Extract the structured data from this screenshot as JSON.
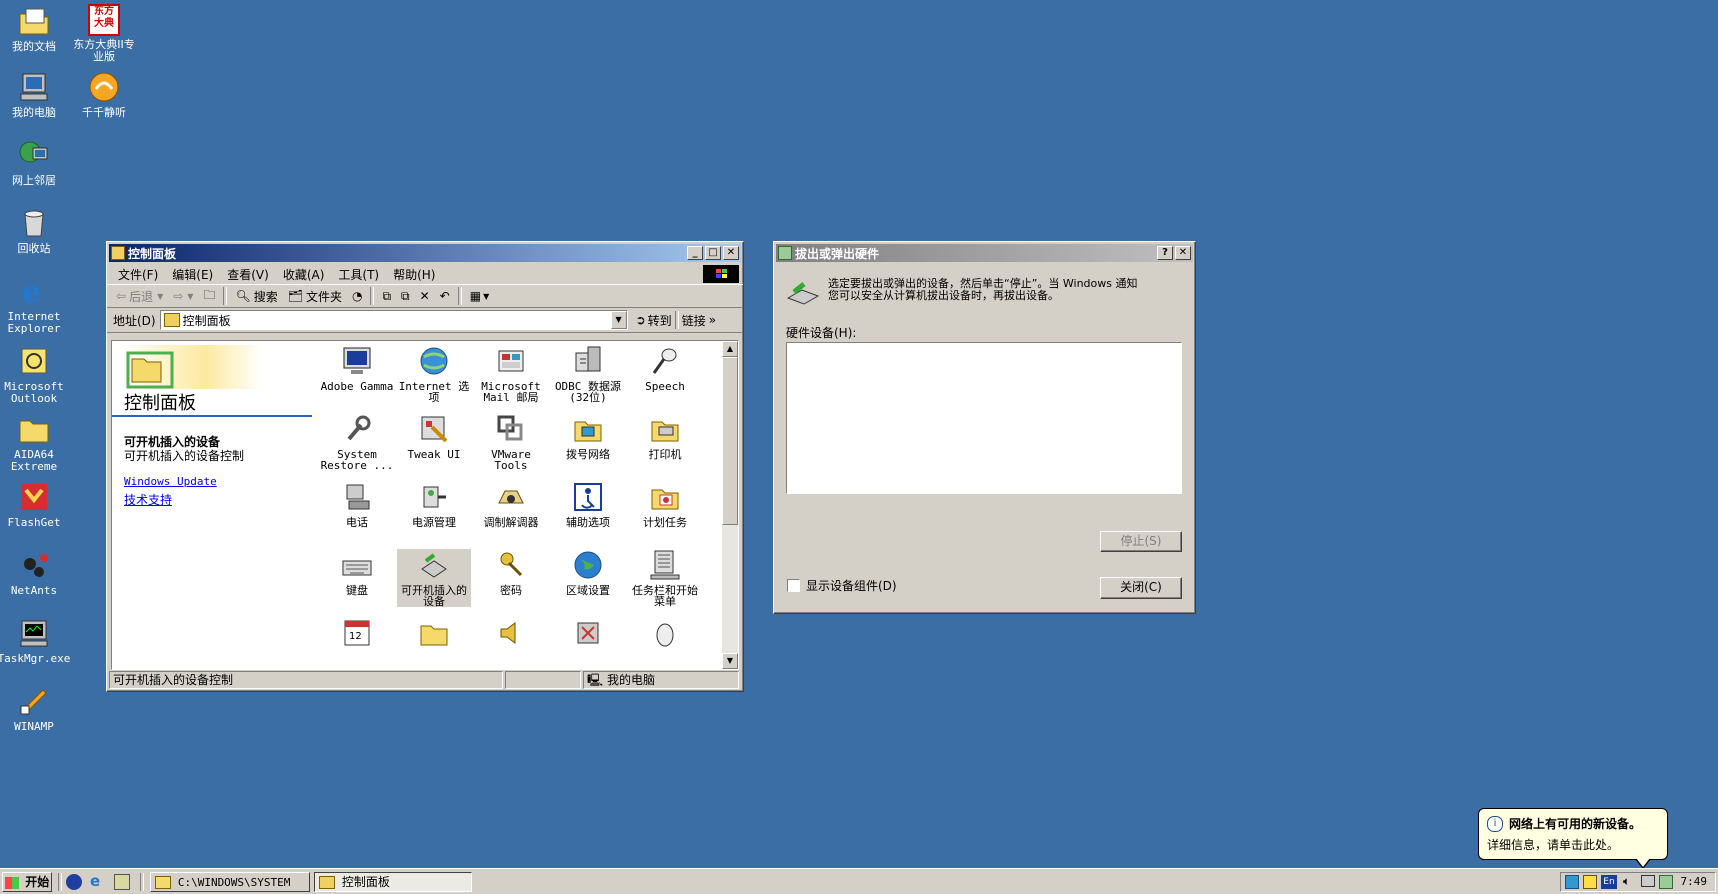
{
  "desktop": {
    "icons": [
      {
        "label": "我的文档"
      },
      {
        "label": "东方大典II专\n业版",
        "logo_text": "东方\n大典"
      },
      {
        "label": "我的电脑"
      },
      {
        "label": "千千静听"
      },
      {
        "label": "网上邻居"
      },
      {
        "label": "回收站"
      },
      {
        "label": "Internet\nExplorer"
      },
      {
        "label": "Microsoft\nOutlook"
      },
      {
        "label": "AIDA64\nExtreme"
      },
      {
        "label": "FlashGet"
      },
      {
        "label": "NetAnts"
      },
      {
        "label": "TaskMgr.exe"
      },
      {
        "label": "WINAMP"
      }
    ]
  },
  "control_panel": {
    "title": "控制面板",
    "menu": [
      "文件(F)",
      "编辑(E)",
      "查看(V)",
      "收藏(A)",
      "工具(T)",
      "帮助(H)"
    ],
    "toolbar": {
      "back": "后退",
      "search": "搜索",
      "folders": "文件夹"
    },
    "address": {
      "label": "地址(D)",
      "value": "控制面板",
      "go": "转到",
      "links": "链接"
    },
    "sidebar": {
      "heading": "控制面板",
      "selected_title": "可开机插入的设备",
      "selected_desc": "可开机插入的设备控制",
      "link1": "Windows Update",
      "link2": "技术支持"
    },
    "items": [
      {
        "label": "Adobe Gamma"
      },
      {
        "label": "Internet 选\n项"
      },
      {
        "label": "Microsoft\nMail 邮局"
      },
      {
        "label": "ODBC 数据源\n(32位)"
      },
      {
        "label": "Speech"
      },
      {
        "label": "System\nRestore ..."
      },
      {
        "label": "Tweak UI"
      },
      {
        "label": "VMware Tools"
      },
      {
        "label": "拨号网络"
      },
      {
        "label": "打印机"
      },
      {
        "label": "电话"
      },
      {
        "label": "电源管理"
      },
      {
        "label": "调制解调器"
      },
      {
        "label": "辅助选项"
      },
      {
        "label": "计划任务"
      },
      {
        "label": "键盘"
      },
      {
        "label": "可开机插入的\n设备"
      },
      {
        "label": "密码"
      },
      {
        "label": "区域设置"
      },
      {
        "label": "任务栏和开始\n菜单"
      }
    ],
    "status": {
      "text": "可开机插入的设备控制",
      "zone": "我的电脑"
    }
  },
  "eject_dialog": {
    "title": "拔出或弹出硬件",
    "description": "选定要拔出或弹出的设备，然后单击“停止”。当 Windows 通知\n您可以安全从计算机拔出设备时，再拔出设备。",
    "hw_label": "硬件设备(H):",
    "stop": "停止(S)",
    "show_components": "显示设备组件(D)",
    "close": "关闭(C)"
  },
  "taskbar": {
    "start": "开始",
    "tasks": [
      "C:\\WINDOWS\\SYSTEM",
      "控制面板"
    ],
    "time": "7:49",
    "lang": "En"
  },
  "balloon": {
    "title": "网络上有可用的新设备。",
    "body": "详细信息，请单击此处。"
  }
}
